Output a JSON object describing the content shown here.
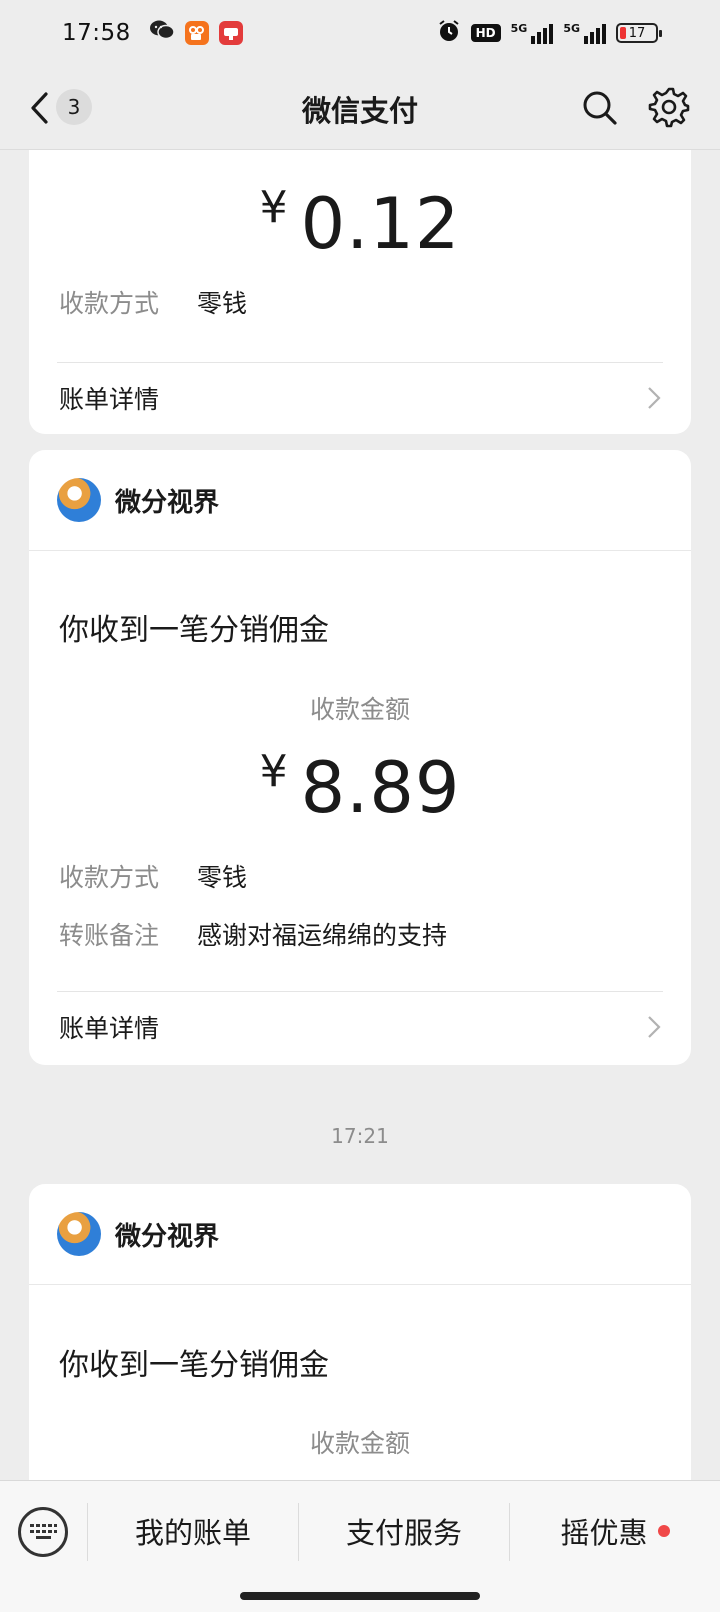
{
  "status_bar": {
    "time": "17:58",
    "battery": "17",
    "hd_label": "HD",
    "network_1": "5G",
    "network_2": "5G"
  },
  "nav": {
    "unread_count": "3",
    "title": "微信支付"
  },
  "card1": {
    "currency": "¥",
    "amount": "0.12",
    "method_label": "收款方式",
    "method_value": "零钱",
    "detail_label": "账单详情"
  },
  "card2": {
    "merchant": "微分视界",
    "headline": "你收到一笔分销佣金",
    "amount_label": "收款金额",
    "currency": "¥",
    "amount": "8.89",
    "method_label": "收款方式",
    "method_value": "零钱",
    "note_label": "转账备注",
    "note_value": "感谢对福运绵绵的支持",
    "detail_label": "账单详情"
  },
  "timestamp": "17:21",
  "card3": {
    "merchant": "微分视界",
    "headline": "你收到一笔分销佣金",
    "amount_label": "收款金额"
  },
  "bottom_bar": {
    "items": [
      "我的账单",
      "支付服务",
      "摇优惠"
    ]
  },
  "colors": {
    "background": "#ededed",
    "card": "#ffffff",
    "muted_text": "#8c8c8c",
    "badge_red": "#f04848"
  },
  "icons": [
    "back-icon",
    "search-icon",
    "gear-icon",
    "chevron-right-icon",
    "keyboard-icon",
    "wechat-icon"
  ]
}
